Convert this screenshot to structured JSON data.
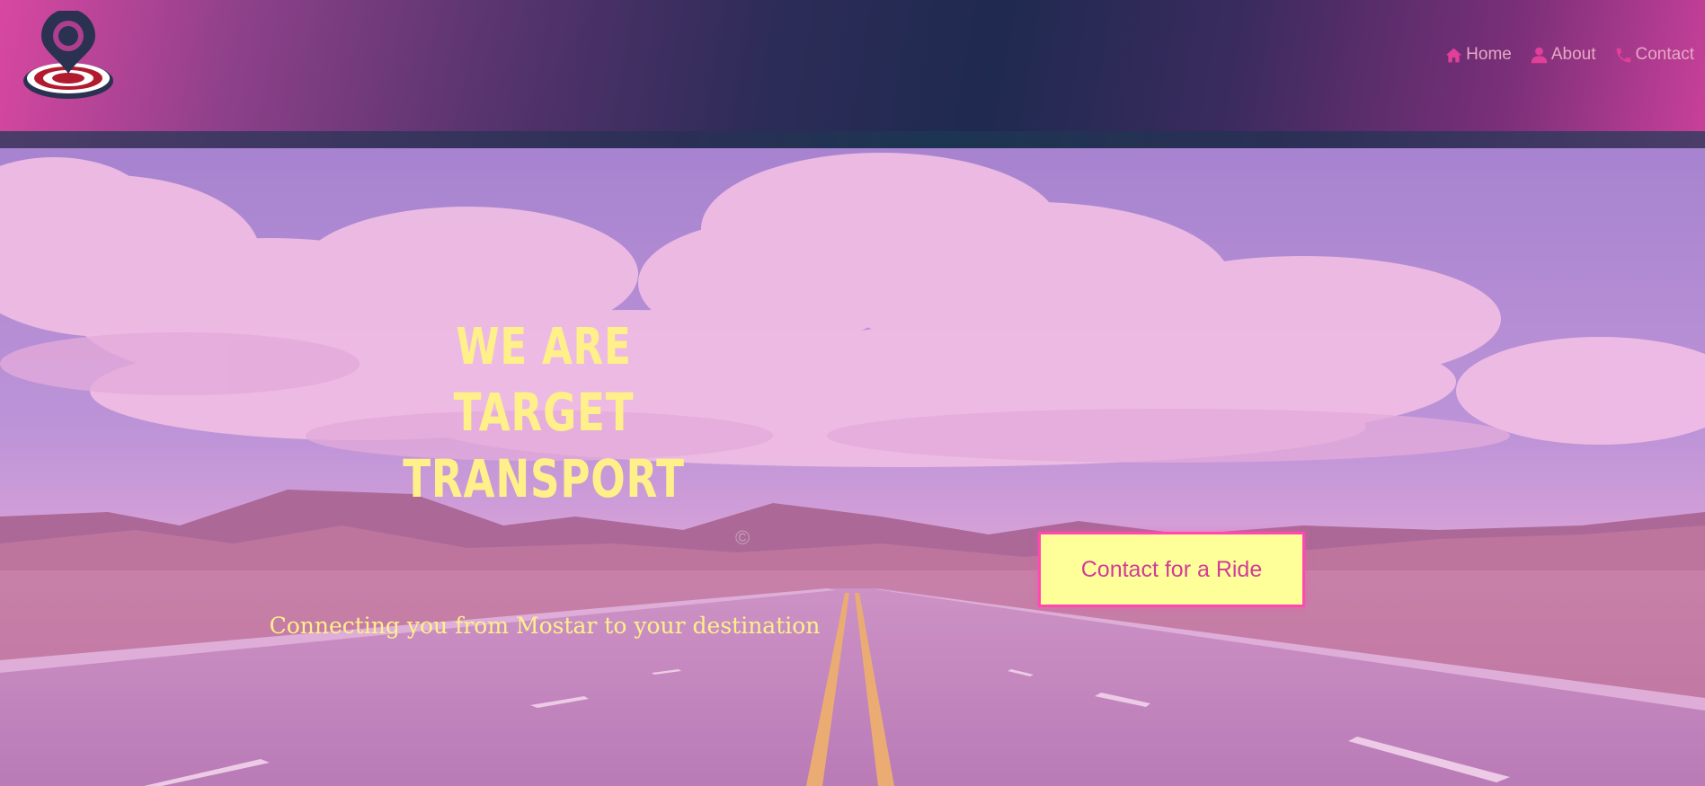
{
  "header": {
    "logo_icon": "target-location-pin-icon",
    "nav": [
      {
        "label": "Home",
        "icon": "home-icon"
      },
      {
        "label": "About",
        "icon": "user-icon"
      },
      {
        "label": "Contact",
        "icon": "phone-icon"
      }
    ]
  },
  "hero": {
    "headline_line1": "WE ARE",
    "headline_line2": "TARGET TRANSPORT",
    "copyright_mark": "©",
    "tagline": "Connecting you from Mostar to your destination",
    "cta_label": "Contact for a Ride"
  },
  "colors": {
    "accent_yellow": "#fff08a",
    "accent_pink": "#d13c98",
    "nav_text": "#e7a8c4",
    "header_dark": "#1f2a50"
  }
}
